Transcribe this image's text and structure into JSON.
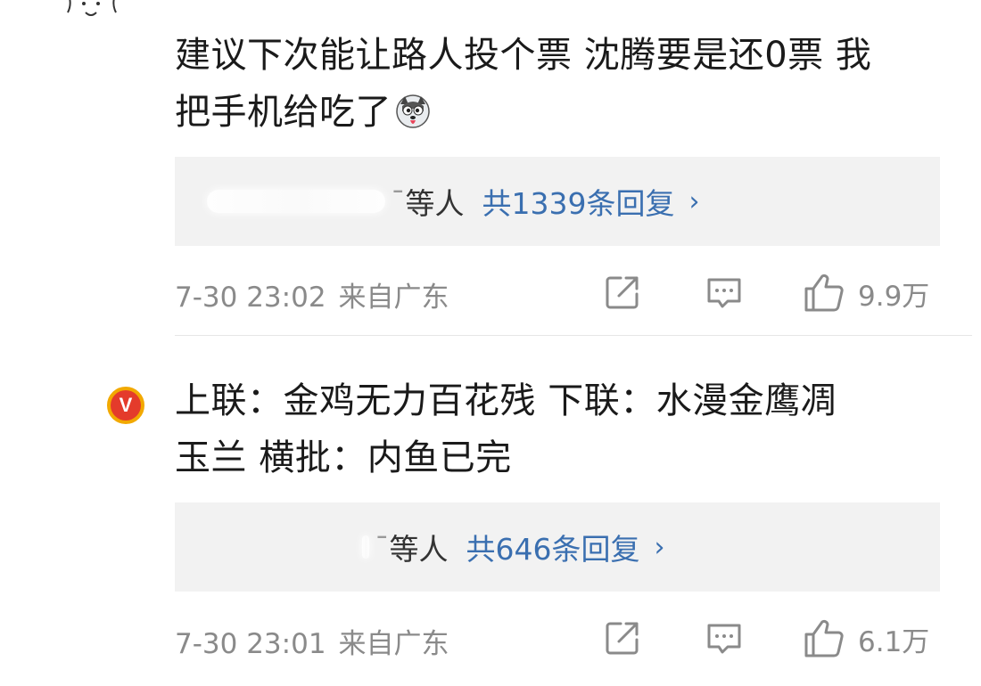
{
  "comments": [
    {
      "text_line1": "建议下次能让路人投个票 沈腾要是还0票 我",
      "text_line2": "把手机给吃了",
      "emoji_icon": "husky-dog-emoji",
      "replies": {
        "partial_name": "ˉ",
        "and_others": "等人",
        "total": "共1339条回复",
        "arrow": "›"
      },
      "date": "7-30 23:02",
      "location": "来自广东",
      "likes": "9.9万"
    },
    {
      "verified_badge": "V",
      "text_line1": "上联：金鸡无力百花残 下联：水漫金鹰凋",
      "text_line2": "玉兰 横批：内鱼已完",
      "replies": {
        "partial_name": "ˉ",
        "and_others": "等人",
        "total": "共646条回复",
        "arrow": "›"
      },
      "date": "7-30 23:01",
      "location": "来自广东",
      "likes": "6.1万"
    }
  ],
  "colors": {
    "link_blue": "#3a6fb0",
    "meta_gray": "#8a8a8a",
    "reply_bg": "#f2f2f2",
    "badge_gold": "#f2a900",
    "badge_red": "#e43b2b"
  }
}
